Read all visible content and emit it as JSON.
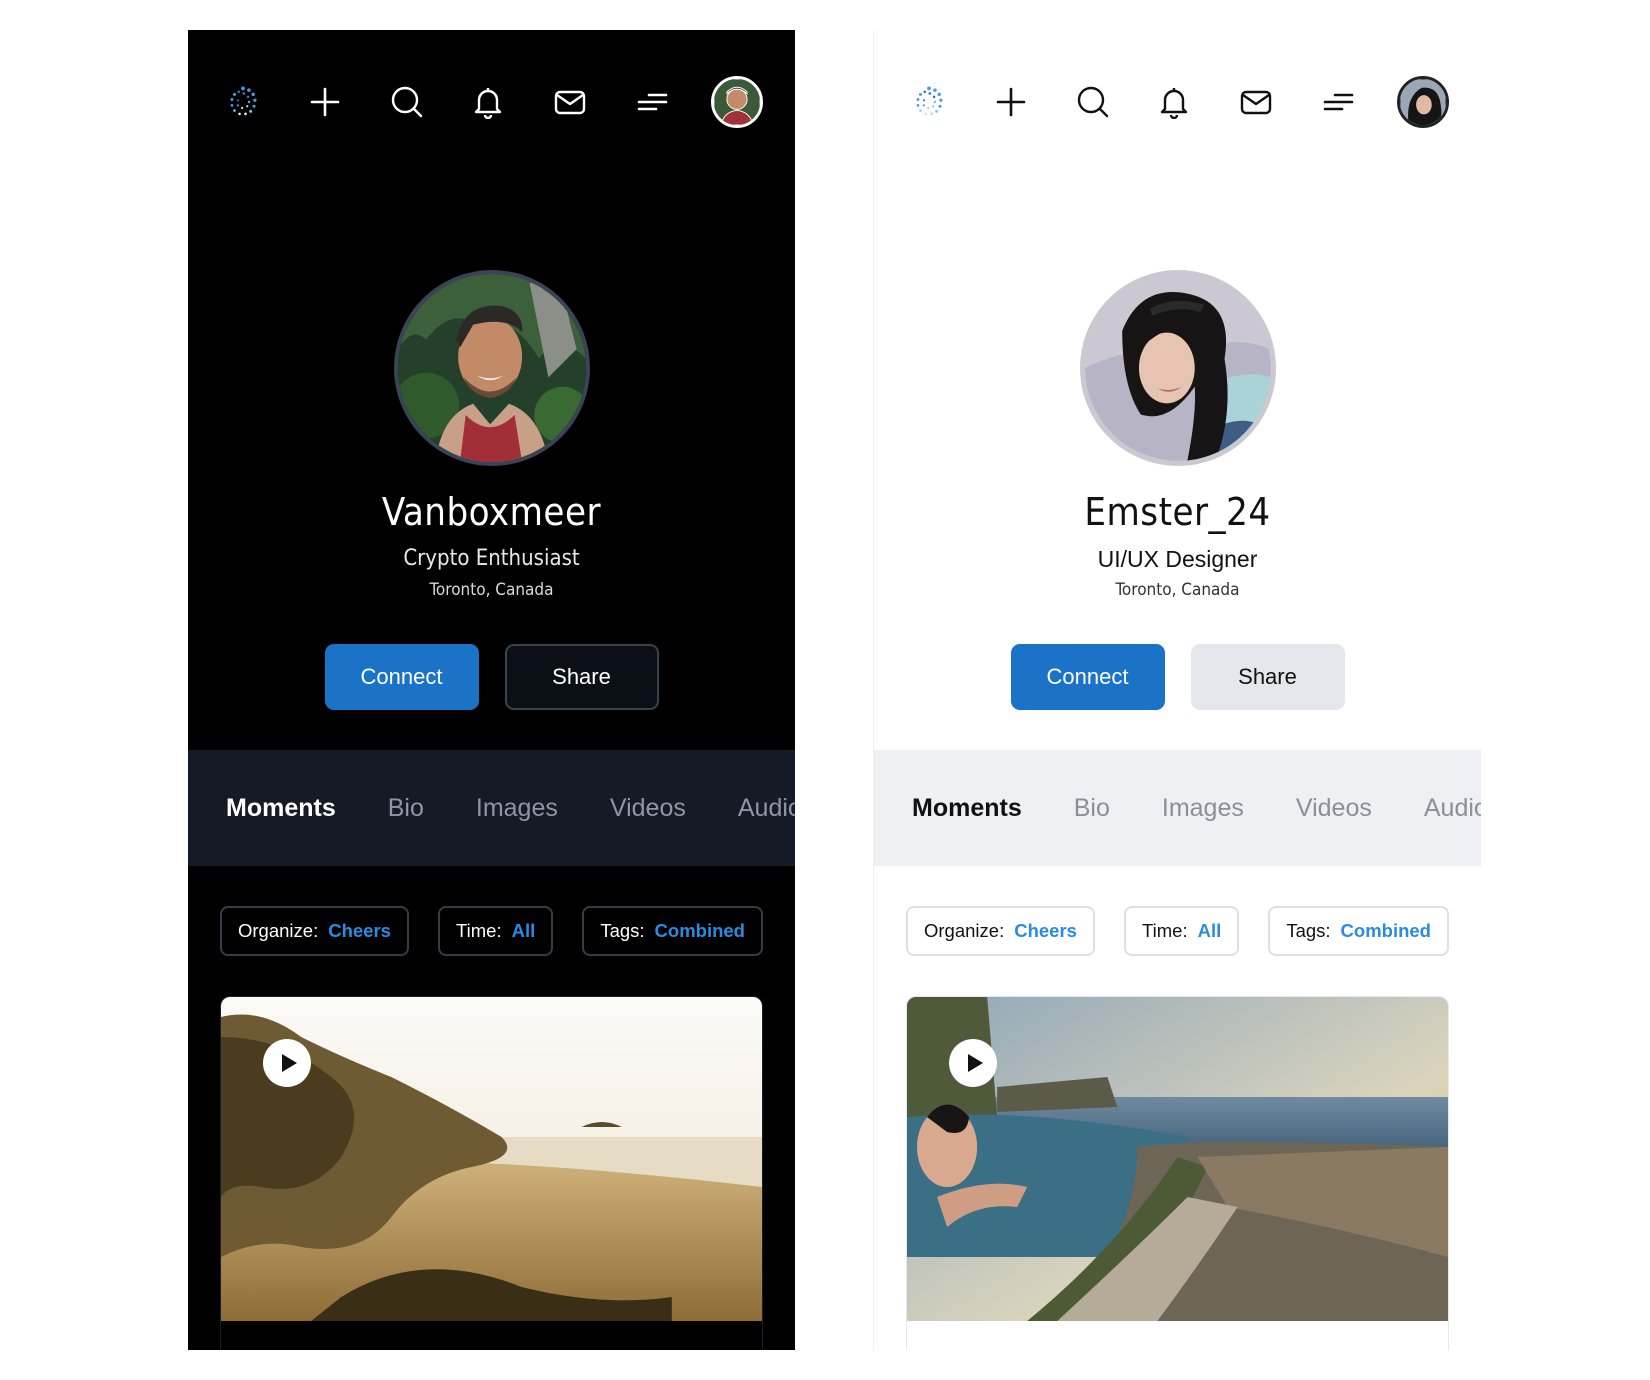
{
  "screens": [
    {
      "theme": "dark",
      "profile": {
        "username": "Vanboxmeer",
        "role": "Crypto Enthusiast",
        "location": "Toronto, Canada"
      },
      "buttons": {
        "connect": "Connect",
        "share": "Share"
      },
      "tabs": [
        "Moments",
        "Bio",
        "Images",
        "Videos",
        "Audio"
      ],
      "active_tab": "Moments",
      "filters": [
        {
          "label": "Organize:",
          "value": "Cheers"
        },
        {
          "label": "Time:",
          "value": "All"
        },
        {
          "label": "Tags:",
          "value": "Combined"
        }
      ],
      "colors": {
        "background": "#000000",
        "tabbar": "#151b26",
        "accent": "#1b73c7",
        "link": "#2a8be2"
      }
    },
    {
      "theme": "light",
      "profile": {
        "username": "Emster_24",
        "role": "UI/UX Designer",
        "location": "Toronto, Canada"
      },
      "buttons": {
        "connect": "Connect",
        "share": "Share"
      },
      "tabs": [
        "Moments",
        "Bio",
        "Images",
        "Videos",
        "Audio"
      ],
      "active_tab": "Moments",
      "filters": [
        {
          "label": "Organize:",
          "value": "Cheers"
        },
        {
          "label": "Time:",
          "value": "All"
        },
        {
          "label": "Tags:",
          "value": "Combined"
        }
      ],
      "colors": {
        "background": "#ffffff",
        "tabbar": "#eef0f3",
        "accent": "#1b73c7",
        "link": "#2a8be2"
      }
    }
  ],
  "nav_icons": [
    "logo-swirl-icon",
    "plus-icon",
    "search-icon",
    "bell-icon",
    "mail-icon",
    "menu-icon",
    "user-avatar"
  ]
}
